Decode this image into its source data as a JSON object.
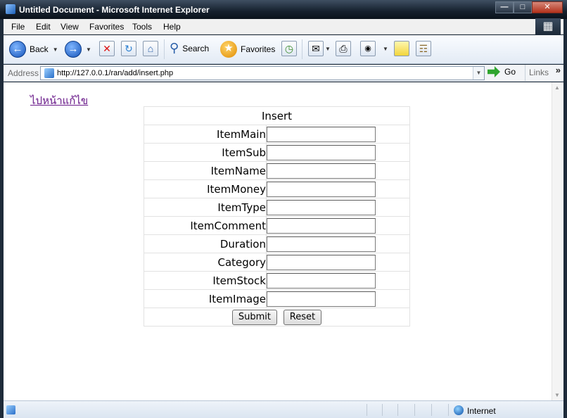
{
  "window": {
    "title": "Untitled Document - Microsoft Internet Explorer"
  },
  "menu": [
    "File",
    "Edit",
    "View",
    "Favorites",
    "Tools",
    "Help"
  ],
  "toolbar": {
    "back": "Back",
    "search": "Search",
    "favorites": "Favorites"
  },
  "address": {
    "label": "Address",
    "url": "http://127.0.0.1/ran/add/insert.php",
    "go": "Go",
    "links": "Links"
  },
  "page": {
    "edit_link": "ไปหน้าแก้ไข",
    "form_title": "Insert",
    "fields": [
      "ItemMain",
      "ItemSub",
      "ItemName",
      "ItemMoney",
      "ItemType",
      "ItemComment",
      "Duration",
      "Category",
      "ItemStock",
      "ItemImage"
    ],
    "submit": "Submit",
    "reset": "Reset"
  },
  "status": {
    "zone": "Internet"
  }
}
